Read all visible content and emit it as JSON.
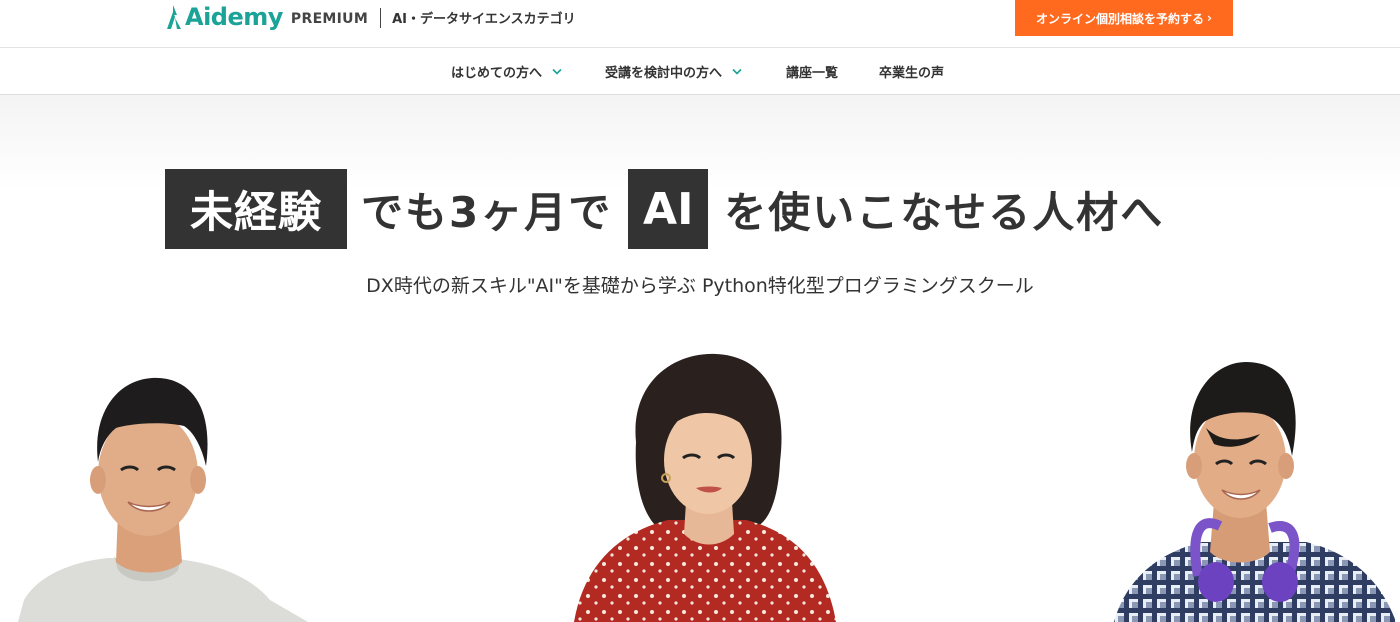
{
  "header": {
    "brand": "Aidemy",
    "brand_tier": "PREMIUM",
    "category": "AI・データサイエンスカテゴリ",
    "cta_label": "オンライン個別相談を予約する",
    "cta_chevron": "›",
    "brand_color": "#1aa396",
    "cta_color": "#ff6a1f"
  },
  "nav": {
    "items": [
      {
        "label": "はじめての方へ",
        "dropdown": true
      },
      {
        "label": "受講を検討中の方へ",
        "dropdown": true
      },
      {
        "label": "講座一覧",
        "dropdown": false
      },
      {
        "label": "卒業生の声",
        "dropdown": false
      }
    ]
  },
  "hero": {
    "headline": {
      "box1": "未経験",
      "mid": "でも3ヶ月で",
      "box2": "AI",
      "end": "を使いこなせる人材へ"
    },
    "subheadline": "DX時代の新スキル\"AI\"を基礎から学ぶ Python特化型プログラミングスクール",
    "photos": [
      {
        "name": "male-student-left"
      },
      {
        "name": "female-student-center"
      },
      {
        "name": "male-student-right-headphones"
      }
    ]
  }
}
